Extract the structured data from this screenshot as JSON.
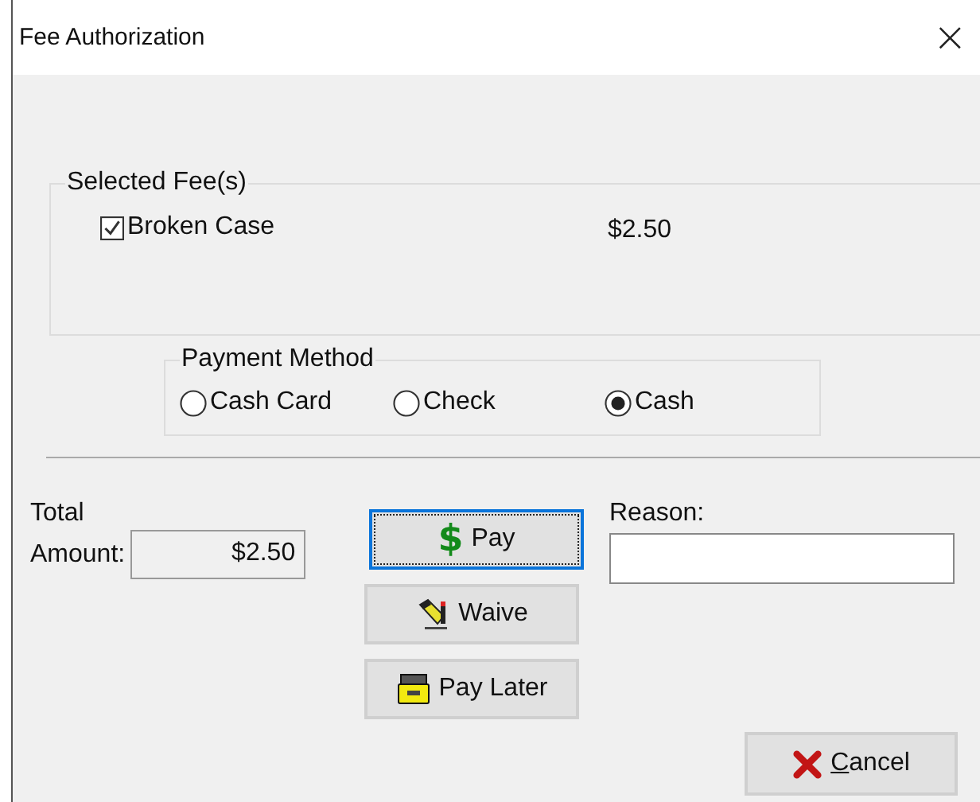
{
  "window": {
    "title": "Fee Authorization",
    "close": "×"
  },
  "fees_group": {
    "label": "Selected Fee(s)",
    "fees": [
      {
        "name": "Broken Case",
        "amount": "$2.50",
        "checked": true
      }
    ]
  },
  "payment_method": {
    "label": "Payment Method",
    "options": [
      {
        "label": "Cash Card",
        "selected": false
      },
      {
        "label": "Check",
        "selected": false
      },
      {
        "label": "Cash",
        "selected": true
      }
    ]
  },
  "total": {
    "label_1": "Total",
    "label_2": "Amount:",
    "value": "$2.50"
  },
  "actions": [
    {
      "label": "Pay",
      "kind": "dollar",
      "symbol": "$",
      "focused": true
    },
    {
      "label": "Waive",
      "kind": "pen",
      "focused": false
    },
    {
      "label": "Pay Later",
      "kind": "drawer",
      "focused": false
    }
  ],
  "reason": {
    "label": "Reason:"
  },
  "cancel": {
    "label": "Cancel"
  }
}
